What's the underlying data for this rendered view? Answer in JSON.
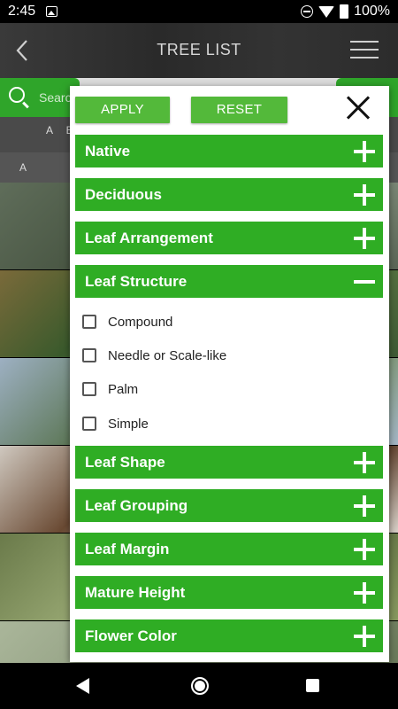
{
  "status_bar": {
    "time": "2:45",
    "battery": "100%"
  },
  "header": {
    "title": "TREE LIST"
  },
  "background": {
    "search_placeholder": "Searc",
    "alpha_index": "A B",
    "section_letter": "A"
  },
  "filter_modal": {
    "apply_label": "APPLY",
    "reset_label": "RESET",
    "sections": [
      {
        "label": "Native",
        "expanded": false
      },
      {
        "label": "Deciduous",
        "expanded": false
      },
      {
        "label": "Leaf Arrangement",
        "expanded": false
      },
      {
        "label": "Leaf Structure",
        "expanded": true
      },
      {
        "label": "Leaf Shape",
        "expanded": false
      },
      {
        "label": "Leaf Grouping",
        "expanded": false
      },
      {
        "label": "Leaf Margin",
        "expanded": false
      },
      {
        "label": "Mature Height",
        "expanded": false
      },
      {
        "label": "Flower Color",
        "expanded": false
      }
    ],
    "leaf_structure_options": [
      {
        "label": "Compound",
        "checked": false
      },
      {
        "label": "Needle or Scale-like",
        "checked": false
      },
      {
        "label": "Palm",
        "checked": false
      },
      {
        "label": "Simple",
        "checked": false
      }
    ]
  },
  "colors": {
    "accent_green": "#2fad24",
    "button_green": "#53b93a"
  }
}
